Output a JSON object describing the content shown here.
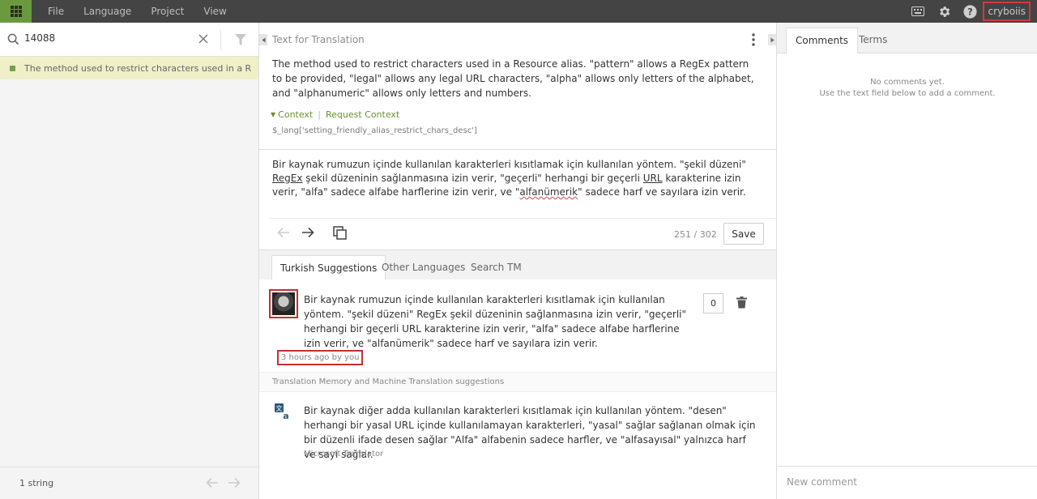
{
  "menu": [
    "File",
    "Language",
    "Project",
    "View"
  ],
  "user": {
    "name": "cryboiis"
  },
  "search": {
    "value": "14088"
  },
  "strings": [
    {
      "text": "The method used to restrict characters used in a Resource alias.",
      "status_color": "#77a04b"
    }
  ],
  "left_footer": {
    "count": "1 string"
  },
  "source": {
    "header": "Text for Translation",
    "text": "The method used to restrict characters used in a Resource alias. \"pattern\" allows a RegEx pattern to be provided, \"legal\" allows any legal URL characters, \"alpha\" allows only letters of the alphabet, and \"alphanumeric\" allows only letters and numbers.",
    "context_label": "Context",
    "request_context": "Request Context",
    "key": "$_lang['setting_friendly_alias_restrict_chars_desc']"
  },
  "translation": {
    "parts": [
      "Bir kaynak rumuzun içinde kullanılan karakterleri kısıtlamak için kullanılan yöntem. \"şekil düzeni\" ",
      "RegEx",
      " şekil düzeninin sağlanmasına izin verir, \"geçerli\" herhangi bir geçerli ",
      "URL",
      " karakterine izin verir, \"alfa\" sadece alfabe harflerine izin verir, ve \"",
      "alfanümerik",
      "\" sadece harf ve sayılara izin verir."
    ],
    "progress": "251 / 302",
    "save_label": "Save"
  },
  "suggestion_tabs": [
    "Turkish Suggestions",
    "Other Languages",
    "Search TM"
  ],
  "suggestion": {
    "text": "Bir kaynak rumuzun içinde kullanılan karakterleri kısıtlamak için kullanılan yöntem. \"şekil düzeni\" RegEx şekil düzeninin sağlanmasına izin verir, \"geçerli\" herhangi bir geçerli URL karakterine izin verir, \"alfa\" sadece alfabe harflerine izin verir, ve \"alfanümerik\" sadece harf ve sayılara izin verir.",
    "meta": "3 hours ago by you",
    "votes": "0"
  },
  "tm": {
    "header": "Translation Memory and Machine Translation suggestions",
    "text": "Bir kaynak diğer adda kullanılan karakterleri kısıtlamak için kullanılan yöntem. \"desen\" herhangi bir yasal URL içinde kullanılamayan karakterleri, \"yasal\" sağlar sağlanan olmak için bir düzenli ifade desen sağlar \"Alfa\" alfabenin sadece harfler, ve \"alfasayısal\" yalnızca harf ve sayı sağlar.",
    "source": "Microsoft Translator"
  },
  "right_tabs": [
    "Comments",
    "Terms"
  ],
  "comments": {
    "empty_line1": "No comments yet.",
    "empty_line2": "Use the text field below to add a comment.",
    "placeholder": "New comment"
  },
  "colors": {
    "accent": "#6b9a3e",
    "highlight": "#c33030",
    "topbar": "#444444"
  }
}
